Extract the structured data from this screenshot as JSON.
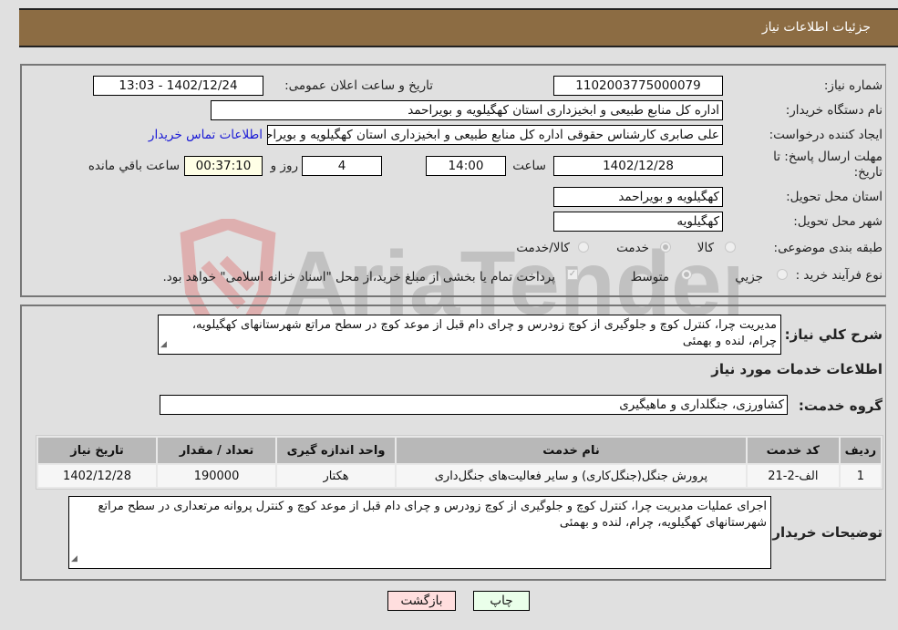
{
  "header": {
    "title": "جزئیات اطلاعات نیاز"
  },
  "need_info": {
    "need_number_label": "شماره نیاز:",
    "need_number": "1102003775000079",
    "announce_label": "تاریخ و ساعت اعلان عمومی:",
    "announce_value": "1402/12/24 - 13:03",
    "buyer_org_label": "نام دستگاه خریدار:",
    "buyer_org": "اداره کل منابع طبیعی و ابخیزداری استان کهگیلویه و بویراحمد",
    "creator_label": "ایجاد کننده درخواست:",
    "creator": "علی صابری کارشناس حقوقی اداره کل منابع طبیعی و ابخیزداری استان کهگیلویه و بویراحمد",
    "contact_link": "اطلاعات تماس خریدار",
    "deadline_label": "مهلت ارسال پاسخ: تا تاریخ:",
    "deadline_date": "1402/12/28",
    "time_label": "ساعت",
    "deadline_time": "14:00",
    "days_value": "4",
    "days_label": "روز و",
    "remaining_time": "00:37:10",
    "remaining_label": "ساعت باقي مانده",
    "province_label": "استان محل تحویل:",
    "province": "کهگیلویه و بویراحمد",
    "city_label": "شهر محل تحویل:",
    "city": "کهگیلویه",
    "category_label": "طبقه بندی موضوعی:",
    "category_options": [
      "کالا",
      "خدمت",
      "کالا/خدمت"
    ],
    "category_selected": "خدمت",
    "process_label": "نوع فرآیند خرید :",
    "process_options": [
      "جزيي",
      "متوسط"
    ],
    "process_selected": "متوسط",
    "payment_note": "پرداخت تمام یا بخشی از مبلغ خرید،از محل \"اسناد خزانه اسلامی\" خواهد بود."
  },
  "details": {
    "summary_label": "شرح کلي نیاز:",
    "summary": "مدیریت چرا، کنترل کوچ و جلوگیری از کوچ زودرس و چرای دام قبل از موعد کوچ در سطح مراتع شهرستانهای کهگیلویه، چرام، لنده و بهمئی",
    "services_heading": "اطلاعات خدمات مورد نیاز",
    "service_group_label": "گروه خدمت:",
    "service_group": "کشاورزی، جنگلداری و ماهیگیری",
    "table": {
      "headers": [
        "ردیف",
        "کد خدمت",
        "نام خدمت",
        "واحد اندازه گیری",
        "تعداد / مقدار",
        "تاریخ نیاز"
      ],
      "rows": [
        [
          "1",
          "الف-2-21",
          "پرورش جنگل(جنگل‌کاری) و سایر فعالیت‌های جنگل‌داری",
          "هکتار",
          "190000",
          "1402/12/28"
        ]
      ]
    },
    "buyer_notes_label": "توضیحات خریدار:",
    "buyer_notes": "اجرای عملیات مدیریت چرا، کنترل کوچ و جلوگیری از کوچ زودرس و چرای دام قبل از موعد کوچ و کنترل پروانه مرتعداری در سطح مراتع شهرستانهای کهگیلویه، چرام، لنده و بهمئی"
  },
  "buttons": {
    "print": "چاپ",
    "back": "بازگشت"
  },
  "watermark": {
    "text": "AriaTender.neT"
  },
  "colors": {
    "header_bg": "#8c6c43",
    "print_bg": "#eaffea",
    "back_bg": "#ffdede",
    "link": "#1a1ad6"
  }
}
